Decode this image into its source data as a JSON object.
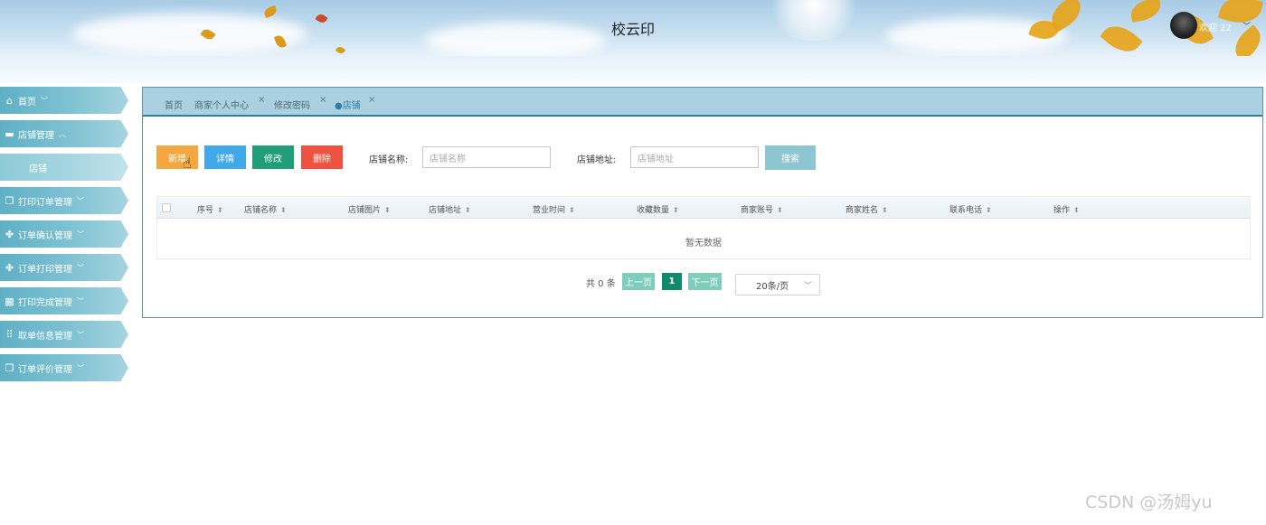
{
  "header": {
    "title": "校云印",
    "welcome": "欢迎 22",
    "avatar_icon": "user-avatar",
    "dropdown_icon": "chevron-down-icon"
  },
  "sidebar": {
    "items": [
      {
        "label": "首页",
        "icon": "home-icon",
        "glyph": "⌂",
        "chevron": "﹀"
      },
      {
        "label": "店铺管理",
        "icon": "shop-icon",
        "glyph": "▬",
        "chevron": "︿"
      },
      {
        "label": "店铺",
        "icon": "",
        "glyph": "",
        "chevron": ""
      },
      {
        "label": "打印订单管理",
        "icon": "copy-icon",
        "glyph": "❐",
        "chevron": "﹀"
      },
      {
        "label": "订单确认管理",
        "icon": "grid-icon",
        "glyph": "✤",
        "chevron": "﹀"
      },
      {
        "label": "订单打印管理",
        "icon": "grid-icon",
        "glyph": "✤",
        "chevron": "﹀"
      },
      {
        "label": "打印完成管理",
        "icon": "layout-icon",
        "glyph": "▦",
        "chevron": "﹀"
      },
      {
        "label": "取单信息管理",
        "icon": "apps-icon",
        "glyph": "⠿",
        "chevron": "﹀"
      },
      {
        "label": "订单评价管理",
        "icon": "copy-icon",
        "glyph": "❐",
        "chevron": "﹀"
      }
    ]
  },
  "tabs": [
    {
      "label": "首页"
    },
    {
      "label": "商家个人中心",
      "close": "×"
    },
    {
      "label": "修改密码",
      "close": "×"
    },
    {
      "label": "●店铺",
      "close": "×"
    }
  ],
  "toolbar": {
    "add": "新增",
    "detail": "详情",
    "edit": "修改",
    "delete": "删除"
  },
  "filters": {
    "name_label": "店铺名称:",
    "name_placeholder": "店铺名称",
    "address_label": "店铺地址:",
    "address_placeholder": "店铺地址",
    "search": "搜索"
  },
  "table": {
    "columns": [
      "序号",
      "店铺名称",
      "店铺图片",
      "店铺地址",
      "营业时间",
      "收藏数量",
      "商家账号",
      "商家姓名",
      "联系电话",
      "操作"
    ],
    "sort_glyph": "⬍",
    "empty_text": "暂无数据"
  },
  "pagination": {
    "total": "共 0 条",
    "prev": "上一页",
    "current": "1",
    "next": "下一页",
    "page_size": "20条/页"
  },
  "watermark": "CSDN @汤姆yu",
  "colors": {
    "primary": "#2f7ca8",
    "add": "#f2a741",
    "detail": "#42a9e8",
    "edit": "#1f9e78",
    "delete": "#ef5340",
    "search": "#8ec5d3",
    "page_active": "#0f8a6a"
  }
}
